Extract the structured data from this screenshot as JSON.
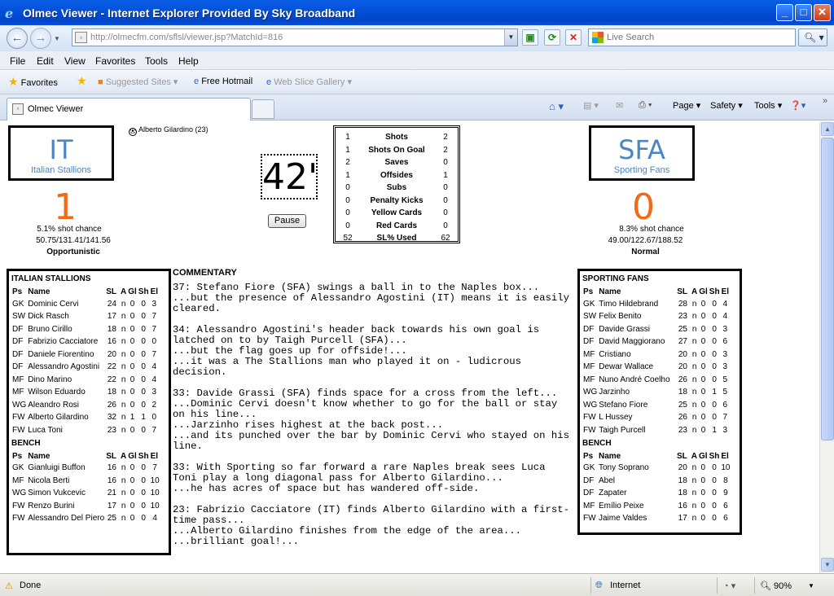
{
  "window": {
    "title": "Olmec Viewer - Internet Explorer Provided By Sky Broadband"
  },
  "address": {
    "url_host": "http://olmecfm.com",
    "url_path": "/sflsl/viewer.jsp?MatchId=816"
  },
  "search": {
    "placeholder": "Live Search"
  },
  "menu": [
    "File",
    "Edit",
    "View",
    "Favorites",
    "Tools",
    "Help"
  ],
  "favorites_bar": {
    "favorites": "Favorites",
    "suggested": "Suggested Sites",
    "hotmail": "Free Hotmail",
    "webslice": "Web Slice Gallery"
  },
  "tab": {
    "label": "Olmec Viewer"
  },
  "commands": {
    "page": "Page",
    "safety": "Safety",
    "tools": "Tools"
  },
  "match": {
    "home": {
      "abbr": "IT",
      "name": "Italian Stallions",
      "score": "1",
      "shot_chance": "5.1% shot chance",
      "ratings": "50.75/131.41/141.56",
      "style": "Opportunistic"
    },
    "away": {
      "abbr": "SFA",
      "name": "Sporting Fans",
      "score": "0",
      "shot_chance": "8.3% shot chance",
      "ratings": "49.00/122.67/188.52",
      "style": "Normal"
    },
    "scorer": "Alberto Gilardino (23)",
    "clock": "42'",
    "pause_label": "Pause",
    "stats": [
      {
        "home": "1",
        "label": "Shots",
        "away": "2"
      },
      {
        "home": "1",
        "label": "Shots On Goal",
        "away": "2"
      },
      {
        "home": "2",
        "label": "Saves",
        "away": "0"
      },
      {
        "home": "1",
        "label": "Offsides",
        "away": "1"
      },
      {
        "home": "0",
        "label": "Subs",
        "away": "0"
      },
      {
        "home": "0",
        "label": "Penalty Kicks",
        "away": "0"
      },
      {
        "home": "0",
        "label": "Yellow Cards",
        "away": "0"
      },
      {
        "home": "0",
        "label": "Red Cards",
        "away": "0"
      },
      {
        "home": "52",
        "label": "SL% Used",
        "away": "62"
      }
    ]
  },
  "rosters": {
    "columns": [
      "Ps",
      "Name",
      "SL",
      "A",
      "Gl",
      "Sh",
      "El"
    ],
    "home_title": "ITALIAN STALLIONS",
    "away_title": "SPORTING FANS",
    "bench_title": "BENCH",
    "home_starters": [
      [
        "GK",
        "Dominic Cervi",
        "24",
        "n",
        "0",
        "0",
        "3"
      ],
      [
        "SW",
        "Dick Rasch",
        "17",
        "n",
        "0",
        "0",
        "7"
      ],
      [
        "DF",
        "Bruno Cirillo",
        "18",
        "n",
        "0",
        "0",
        "7"
      ],
      [
        "DF",
        "Fabrizio Cacciatore",
        "16",
        "n",
        "0",
        "0",
        "0"
      ],
      [
        "DF",
        "Daniele Fiorentino",
        "20",
        "n",
        "0",
        "0",
        "7"
      ],
      [
        "DF",
        "Alessandro Agostini",
        "22",
        "n",
        "0",
        "0",
        "4"
      ],
      [
        "MF",
        "Dino Marino",
        "22",
        "n",
        "0",
        "0",
        "4"
      ],
      [
        "MF",
        "Wilson Eduardo",
        "18",
        "n",
        "0",
        "0",
        "3"
      ],
      [
        "WG",
        "Aleandro Rosi",
        "26",
        "n",
        "0",
        "0",
        "2"
      ],
      [
        "FW",
        "Alberto Gilardino",
        "32",
        "n",
        "1",
        "1",
        "0"
      ],
      [
        "FW",
        "Luca Toni",
        "23",
        "n",
        "0",
        "0",
        "7"
      ]
    ],
    "home_bench": [
      [
        "GK",
        "Gianluigi Buffon",
        "16",
        "n",
        "0",
        "0",
        "7"
      ],
      [
        "MF",
        "Nicola Berti",
        "16",
        "n",
        "0",
        "0",
        "10"
      ],
      [
        "WG",
        "Simon Vukcevic",
        "21",
        "n",
        "0",
        "0",
        "10"
      ],
      [
        "FW",
        "Renzo Burini",
        "17",
        "n",
        "0",
        "0",
        "10"
      ],
      [
        "FW",
        "Alessandro Del Piero",
        "25",
        "n",
        "0",
        "0",
        "4"
      ]
    ],
    "away_starters": [
      [
        "GK",
        "Timo Hildebrand",
        "28",
        "n",
        "0",
        "0",
        "4"
      ],
      [
        "SW",
        "Felix Benito",
        "23",
        "n",
        "0",
        "0",
        "4"
      ],
      [
        "DF",
        "Davide Grassi",
        "25",
        "n",
        "0",
        "0",
        "3"
      ],
      [
        "DF",
        "David Maggiorano",
        "27",
        "n",
        "0",
        "0",
        "6"
      ],
      [
        "MF",
        "Cristiano",
        "20",
        "n",
        "0",
        "0",
        "3"
      ],
      [
        "MF",
        "Dewar Wallace",
        "20",
        "n",
        "0",
        "0",
        "3"
      ],
      [
        "MF",
        "Nuno André Coelho",
        "26",
        "n",
        "0",
        "0",
        "5"
      ],
      [
        "WG",
        "Jarzinho",
        "18",
        "n",
        "0",
        "1",
        "5"
      ],
      [
        "WG",
        "Stefano Fiore",
        "25",
        "n",
        "0",
        "0",
        "6"
      ],
      [
        "FW",
        "L Hussey",
        "26",
        "n",
        "0",
        "0",
        "7"
      ],
      [
        "FW",
        "Taigh Purcell",
        "23",
        "n",
        "0",
        "1",
        "3"
      ]
    ],
    "away_bench": [
      [
        "GK",
        "Tony Soprano",
        "20",
        "n",
        "0",
        "0",
        "10"
      ],
      [
        "DF",
        "Abel",
        "18",
        "n",
        "0",
        "0",
        "8"
      ],
      [
        "DF",
        "Zapater",
        "18",
        "n",
        "0",
        "0",
        "9"
      ],
      [
        "MF",
        "Emílio Peixe",
        "16",
        "n",
        "0",
        "0",
        "6"
      ],
      [
        "FW",
        "Jaime Valdes",
        "17",
        "n",
        "0",
        "0",
        "6"
      ]
    ]
  },
  "commentary": {
    "heading": "COMMENTARY",
    "entries": [
      [
        "37: Stefano Fiore (SFA) swings a ball in to the Naples box...",
        "...but the presence of Alessandro Agostini (IT) means it is easily cleared."
      ],
      [
        "34: Alessandro Agostini's header back towards his own goal is latched on to by Taigh Purcell (SFA)...",
        "...but the flag goes up for offside!...",
        "...it was a The Stallions man who played it on - ludicrous decision."
      ],
      [
        "33: Davide Grassi (SFA) finds space for a cross from the left...",
        "...Dominic Cervi doesn't know whether to go for the ball or stay on his line...",
        "...Jarzinho rises highest at the back post...",
        "...and its punched over the bar by Dominic Cervi who stayed on his line."
      ],
      [
        "33: With Sporting so far forward a rare Naples break sees Luca Toni play a long diagonal pass for Alberto Gilardino...",
        "...he has acres of space but has wandered off-side."
      ],
      [
        "23: Fabrizio Cacciatore (IT) finds Alberto Gilardino with a first-time pass...",
        "...Alberto Gilardino finishes from the edge of the area...",
        "...brilliant goal!..."
      ]
    ]
  },
  "status": {
    "left": "Done",
    "zone": "Internet",
    "zoom": "90%"
  }
}
